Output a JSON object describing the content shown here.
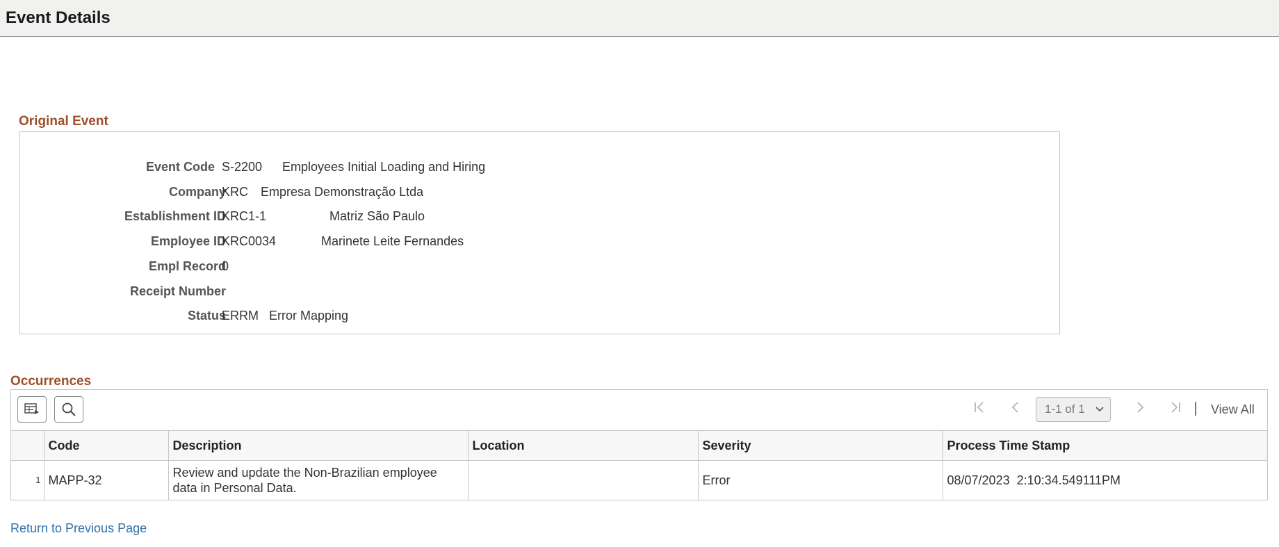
{
  "page": {
    "title": "Event Details"
  },
  "original_event": {
    "section_title": "Original Event",
    "fields": [
      {
        "label": "Event Code",
        "value": "S-2200",
        "desc": "Employees Initial Loading and Hiring"
      },
      {
        "label": "Company",
        "value": "KRC",
        "desc": "Empresa Demonstração Ltda"
      },
      {
        "label": "Establishment ID",
        "value": "KRC1-1",
        "desc": "Matriz São Paulo"
      },
      {
        "label": "Employee ID",
        "value": "KRC0034",
        "desc": "Marinete Leite Fernandes"
      },
      {
        "label": "Empl Record",
        "value": "0"
      },
      {
        "label": "Receipt Number",
        "value": ""
      },
      {
        "label": "Status",
        "value": "ERRM",
        "desc": "Error Mapping"
      }
    ]
  },
  "occurrences": {
    "section_title": "Occurrences",
    "pager": {
      "range": "1-1 of 1",
      "view_all": "View All"
    },
    "columns": [
      "Code",
      "Description",
      "Location",
      "Severity",
      "Process Time Stamp"
    ],
    "rows": [
      {
        "num": "1",
        "code": "MAPP-32",
        "description": "Review and update the Non-Brazilian employee data in Personal Data.",
        "location": "",
        "severity": "Error",
        "timestamp": "08/07/2023  2:10:34.549111PM"
      }
    ]
  },
  "footer": {
    "return_link": "Return to Previous Page"
  },
  "colors": {
    "section_title": "#9e4f27",
    "link": "#2f6fa8",
    "header_bg": "#f1f1f0"
  }
}
